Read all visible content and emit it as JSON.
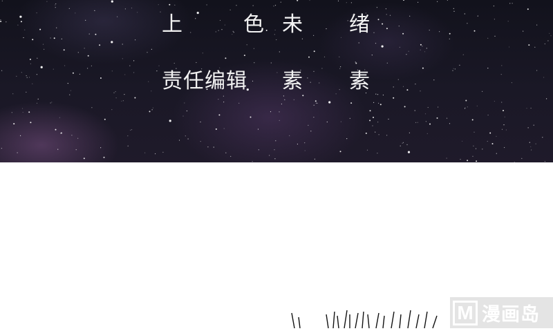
{
  "credits": {
    "color_row": [
      "上",
      "色",
      "未",
      "绪"
    ],
    "editor_row": [
      "责任编辑",
      "素",
      "素"
    ]
  },
  "watermark": {
    "logo": "M",
    "text": "漫画岛"
  },
  "colors": {
    "night_sky": "#1a1826",
    "credit_text": "#f2f2f2",
    "page_background": "#ffffff"
  }
}
